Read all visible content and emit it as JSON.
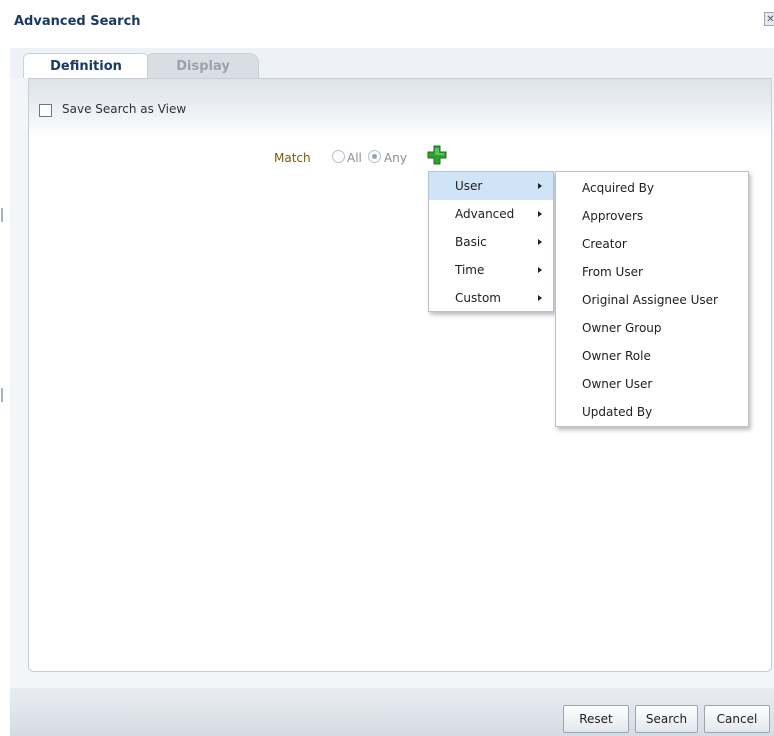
{
  "dialog": {
    "title": "Advanced Search",
    "close_glyph": "✕"
  },
  "tabs": [
    {
      "label": "Definition",
      "active": true
    },
    {
      "label": "Display",
      "active": false
    }
  ],
  "save_view": {
    "label": "Save Search as View",
    "checked": false
  },
  "match": {
    "label": "Match",
    "options": [
      {
        "label": "All",
        "selected": false
      },
      {
        "label": "Any",
        "selected": true
      }
    ],
    "add_icon": "green-plus-icon"
  },
  "category_menu": {
    "items": [
      "User",
      "Advanced",
      "Basic",
      "Time",
      "Custom"
    ],
    "active": "User"
  },
  "user_submenu": {
    "items": [
      "Acquired By",
      "Approvers",
      "Creator",
      "From User",
      "Original Assignee User",
      "Owner Group",
      "Owner Role",
      "Owner User",
      "Updated By"
    ]
  },
  "buttons": {
    "reset": "Reset",
    "search": "Search",
    "cancel": "Cancel"
  },
  "colors": {
    "title": "#1b3a63",
    "match_label": "#7a5b12",
    "menu_highlight": "#cfe4f7",
    "add_icon": "#2fa12f"
  }
}
